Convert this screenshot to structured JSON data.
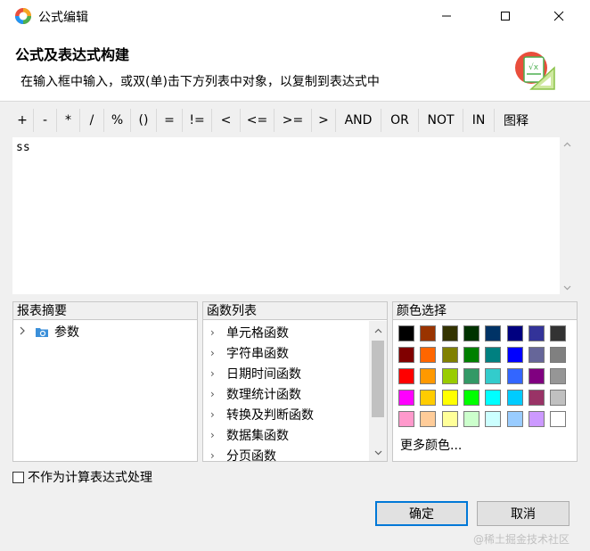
{
  "window": {
    "title": "公式编辑"
  },
  "header": {
    "title": "公式及表达式构建",
    "description": "在输入框中输入，或双(单)击下方列表中对象，以复制到表达式中"
  },
  "operators": [
    "+",
    "-",
    "*",
    "/",
    "%",
    "()",
    "=",
    "!=",
    "<",
    "<=",
    ">=",
    ">",
    "AND",
    "OR",
    "NOT",
    "IN",
    "图释"
  ],
  "editor": {
    "value": "ss"
  },
  "summary_panel": {
    "title": "报表摘要",
    "items": [
      {
        "label": "参数"
      }
    ]
  },
  "functions_panel": {
    "title": "函数列表",
    "items": [
      "单元格函数",
      "字符串函数",
      "日期时间函数",
      "数理统计函数",
      "转换及判断函数",
      "数据集函数",
      "分页函数"
    ]
  },
  "colors_panel": {
    "title": "颜色选择",
    "colors": [
      "#000000",
      "#993300",
      "#333300",
      "#003300",
      "#003366",
      "#000080",
      "#333399",
      "#333333",
      "#800000",
      "#ff6600",
      "#808000",
      "#008000",
      "#008080",
      "#0000ff",
      "#666699",
      "#808080",
      "#ff0000",
      "#ff9900",
      "#99cc00",
      "#339966",
      "#33cccc",
      "#3366ff",
      "#800080",
      "#969696",
      "#ff00ff",
      "#ffcc00",
      "#ffff00",
      "#00ff00",
      "#00ffff",
      "#00ccff",
      "#993366",
      "#c0c0c0",
      "#ff99cc",
      "#ffcc99",
      "#ffff99",
      "#ccffcc",
      "#ccffff",
      "#99ccff",
      "#cc99ff",
      "#ffffff"
    ],
    "more_label": "更多颜色..."
  },
  "checkbox": {
    "label": "不作为计算表达式处理",
    "checked": false
  },
  "buttons": {
    "ok": "确定",
    "cancel": "取消"
  },
  "watermark": "@稀土掘金技术社区"
}
